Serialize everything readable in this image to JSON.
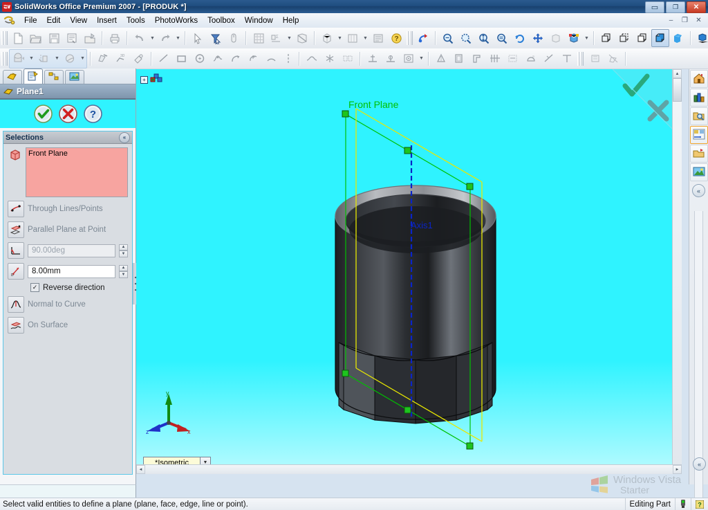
{
  "window": {
    "title": "SolidWorks Office Premium 2007 - [PRODUK *]",
    "app_icon": "solidworks-logo-icon",
    "buttons": {
      "minimize": "–",
      "restore": "❐",
      "close": "✕"
    },
    "mdi_buttons": {
      "minimize": "–",
      "restore": "❐",
      "close": "✕"
    }
  },
  "menubar": {
    "logo_icon": "solidworks-menu-logo-icon",
    "items": [
      {
        "label": "File"
      },
      {
        "label": "Edit"
      },
      {
        "label": "View"
      },
      {
        "label": "Insert"
      },
      {
        "label": "Tools"
      },
      {
        "label": "PhotoWorks"
      },
      {
        "label": "Toolbox"
      },
      {
        "label": "Window"
      },
      {
        "label": "Help"
      }
    ]
  },
  "toolbar_row1": {
    "icons": [
      "new-document-icon",
      "open-folder-icon",
      "save-icon",
      "print-preview-icon",
      "pack-and-go-icon",
      "print-icon",
      "undo-icon",
      "redo-icon",
      "select-arrow-icon",
      "filter-icon",
      "magnifier-mouse-icon",
      "grid-icon",
      "measure-icon",
      "section-view-icon",
      "view-orientation-icon",
      "display-style-icon",
      "shaded-icon",
      "help-question-icon",
      "rebuild-icon",
      "zoom-to-fit-icon",
      "zoom-to-area-icon",
      "zoom-in-out-icon",
      "zoom-to-selection-icon",
      "rotate-view-icon",
      "pan-icon",
      "previous-view-icon",
      "appearance-icon",
      "wireframe-icon",
      "hidden-lines-visible-icon",
      "hidden-lines-removed-icon",
      "shaded-with-edges-icon",
      "shaded-view-icon",
      "shadows-icon",
      "section-icon",
      "realview-icon"
    ]
  },
  "toolbar_row2": {
    "icons": [
      "extruded-boss-icon",
      "revolved-boss-icon",
      "swept-boss-icon",
      "sketch-icon",
      "3d-sketch-icon",
      "smart-dimension-icon",
      "line-icon",
      "rectangle-icon",
      "circle-icon",
      "spline-icon",
      "arc-icon",
      "perimeter-circle-icon",
      "tangent-arc-icon",
      "centerline-icon",
      "sketch-fillet-icon",
      "point-icon",
      "mirror-entities-icon",
      "plane-icon",
      "axis-icon",
      "coordinate-system-icon",
      "reference-geometry-icon",
      "draft-icon",
      "shell-icon",
      "rib-icon",
      "pattern-icon",
      "wrap-icon",
      "dome-icon",
      "curve-icon",
      "trim-icon"
    ]
  },
  "toolbar_right": {
    "icons": [
      "edit-part-icon",
      "edit-sketch-icon"
    ]
  },
  "property_manager": {
    "tabs": [
      {
        "name": "feature-manager-tab",
        "icon": "feature-tree-icon",
        "selected": false
      },
      {
        "name": "property-manager-tab",
        "icon": "property-clipboard-icon",
        "selected": true
      },
      {
        "name": "configuration-manager-tab",
        "icon": "configuration-icon",
        "selected": false
      },
      {
        "name": "display-manager-tab",
        "icon": "display-manager-icon",
        "selected": false
      }
    ],
    "header": {
      "icon": "plane-header-icon",
      "title": "Plane1"
    },
    "actions": {
      "ok": {
        "name": "ok-button",
        "glyph": "✔"
      },
      "cancel": {
        "name": "cancel-button",
        "glyph": "✖"
      },
      "help": {
        "name": "help-button",
        "glyph": "?"
      }
    },
    "selections": {
      "section_title": "Selections",
      "collapse_glyph": "«",
      "selected_entity": "Front Plane",
      "entity_icon": "plane-selection-icon"
    },
    "options": [
      {
        "name": "through-lines-points",
        "label": "Through Lines/Points",
        "icon": "through-lines-points-icon",
        "enabled": false
      },
      {
        "name": "parallel-plane-at-point",
        "label": "Parallel Plane at Point",
        "icon": "parallel-plane-icon",
        "enabled": false
      },
      {
        "name": "at-angle",
        "label": "",
        "icon": "angle-icon",
        "value": "90.00deg",
        "enabled": false,
        "has_field": true
      },
      {
        "name": "offset-distance",
        "label": "",
        "icon": "offset-distance-icon",
        "value": "8.00mm",
        "enabled": true,
        "has_field": true
      },
      {
        "name": "normal-to-curve",
        "label": "Normal to Curve",
        "icon": "normal-to-curve-icon",
        "enabled": false
      },
      {
        "name": "on-surface",
        "label": "On Surface",
        "icon": "on-surface-icon",
        "enabled": false
      }
    ],
    "reverse_direction": {
      "label": "Reverse direction",
      "checked": true,
      "check_glyph": "✓"
    }
  },
  "viewport": {
    "background_color": "#2ff3ff",
    "tree_root_icon": "feature-tree-root-icon",
    "tree_expand_glyph": "+",
    "confirm_corner": {
      "ok_glyph": "✔",
      "cancel_glyph": "✘"
    },
    "annotations": [
      {
        "name": "front-plane-label",
        "text": "Front Plane",
        "color": "#00c000"
      },
      {
        "name": "axis-label",
        "text": "Axis1",
        "color": "#0a24c8"
      }
    ],
    "triad": {
      "x_label": "x",
      "y_label": "y",
      "z_label": "z",
      "x_color": "#cc1111",
      "y_color": "#118811",
      "z_color": "#1133cc"
    },
    "view_selector": {
      "value": "*Isometric",
      "arrow_glyph": "▼"
    },
    "model": {
      "name": "hex-socket-cylinder",
      "body_color": "#3a3c40",
      "rim_color": "#9a9ca0",
      "sketch_line_color": "#e8e800",
      "plane_line_color": "#00c000",
      "axis_color": "#0a24c8"
    }
  },
  "task_pane": {
    "buttons": [
      {
        "name": "solidworks-resources",
        "icon": "home-icon",
        "highlighted": false
      },
      {
        "name": "design-library",
        "icon": "library-icon",
        "highlighted": false
      },
      {
        "name": "file-explorer",
        "icon": "folder-search-icon",
        "highlighted": false
      },
      {
        "name": "search",
        "icon": "search-palette-icon",
        "highlighted": true
      },
      {
        "name": "view-palette",
        "icon": "view-palette-icon",
        "highlighted": false
      },
      {
        "name": "appearances-scenes",
        "icon": "appearances-icon",
        "highlighted": false
      }
    ],
    "collapse_glyph": "«"
  },
  "statusbar": {
    "message": "Select valid entities to define a plane (plane, face, edge, line or point).",
    "mode": "Editing Part",
    "indicator_icon": "traffic-light-icon",
    "help_icon": "help-question-icon"
  },
  "watermark": {
    "line1": "Windows Vista",
    "line2": "Starter",
    "icon": "windows-flag-icon"
  }
}
